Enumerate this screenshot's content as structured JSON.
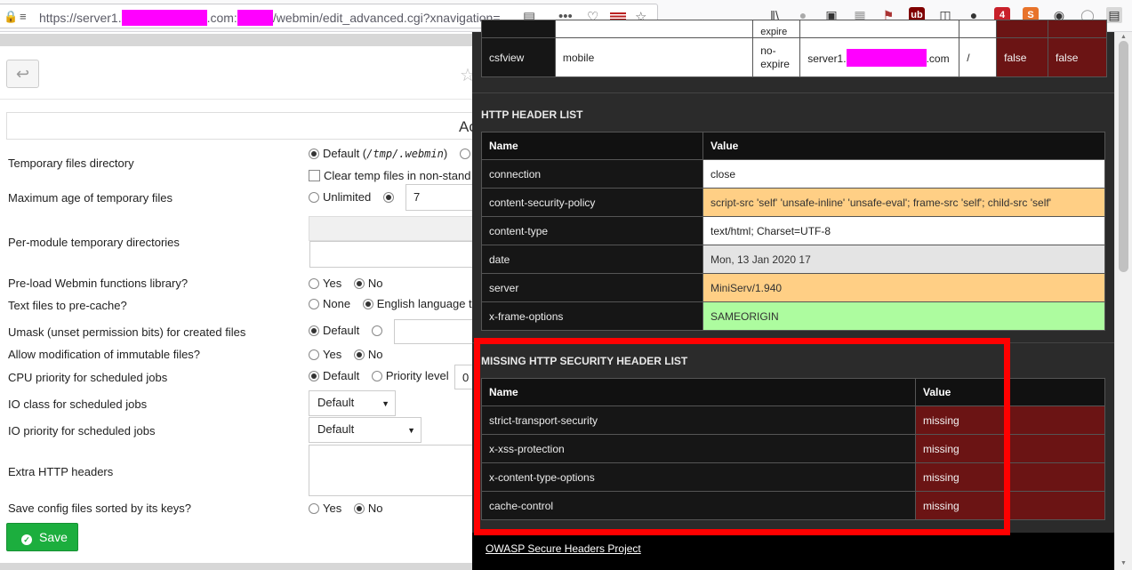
{
  "browser": {
    "url_parts": [
      "https://server1.",
      ".com:",
      "/webmin/edit_advanced.cgi?xnavigation="
    ],
    "icons": [
      "lock-icon",
      "settings-icon",
      "reader-icon",
      "more-icon",
      "pocket-icon",
      "flag-icon",
      "bookmark-star-icon",
      "library-icon",
      "sync-icon",
      "screenshot-icon",
      "reader-view-icon",
      "extension-icon",
      "ublock-icon",
      "sidebar-icon",
      "extension-icon",
      "extension-icon",
      "extension-icon",
      "account-icon",
      "shield-icon",
      "headers-extension-icon"
    ],
    "badges": {
      "ublock": "ub",
      "four": "4",
      "s": "S"
    }
  },
  "page": {
    "panel_title_fragment": "Ac",
    "rows": [
      {
        "label": "Temporary files directory"
      },
      {
        "label": "Maximum age of temporary files"
      },
      {
        "label": "Per-module temporary directories"
      },
      {
        "label": "Pre-load Webmin functions library?"
      },
      {
        "label": "Text files to pre-cache?"
      },
      {
        "label": "Umask (unset permission bits) for created files"
      },
      {
        "label": "Allow modification of immutable files?"
      },
      {
        "label": "CPU priority for scheduled jobs"
      },
      {
        "label": "IO class for scheduled jobs"
      },
      {
        "label": "IO priority for scheduled jobs"
      },
      {
        "label": "Extra HTTP headers"
      },
      {
        "label": "Save config files sorted by its keys?"
      }
    ],
    "opts": {
      "default_paren": "Default (",
      "tmp_path": "/tmp/.webmin",
      "close_paren": ")",
      "clear_temp": "Clear temp files in non-stand",
      "unlimited": "Unlimited",
      "max_age_value": "7",
      "yes": "Yes",
      "no": "No",
      "none": "None",
      "english": "English language te",
      "default": "Default",
      "priority_level": "Priority level",
      "priority_value": "0"
    },
    "save_label": "Save"
  },
  "overlay": {
    "cookie_row": {
      "name": "csfview",
      "value": "mobile",
      "expire": "no-\nexpire",
      "expire_top": "expire",
      "domain_pre": "server1.",
      "domain_post": ".com",
      "path": "/",
      "secure": "false",
      "httponly": "false"
    },
    "http_header_title": "HTTP HEADER LIST",
    "http_headers": {
      "col_name": "Name",
      "col_value": "Value",
      "rows": [
        {
          "name": "connection",
          "value": "close",
          "tone": "white"
        },
        {
          "name": "content-security-policy",
          "value": "script-src 'self' 'unsafe-inline' 'unsafe-eval'; frame-src 'self'; child-src 'self'",
          "tone": "orange"
        },
        {
          "name": "content-type",
          "value": "text/html; Charset=UTF-8",
          "tone": "white"
        },
        {
          "name": "date",
          "value": "Mon, 13 Jan 2020 17",
          "tone": "grey"
        },
        {
          "name": "server",
          "value": "MiniServ/1.940",
          "tone": "orange"
        },
        {
          "name": "x-frame-options",
          "value": "SAMEORIGIN",
          "tone": "green"
        }
      ]
    },
    "missing_title": "MISSING HTTP SECURITY HEADER LIST",
    "missing_headers": {
      "col_name": "Name",
      "col_value": "Value",
      "rows": [
        {
          "name": "strict-transport-security",
          "value": "missing"
        },
        {
          "name": "x-xss-protection",
          "value": "missing"
        },
        {
          "name": "x-content-type-options",
          "value": "missing"
        },
        {
          "name": "cache-control",
          "value": "missing"
        }
      ]
    },
    "owasp_link": "OWASP Secure Headers Project"
  },
  "colors": {
    "highlight": "#ff0000",
    "missing_red": "#6b1414",
    "orange": "#ffcf85",
    "green": "#adfc9f",
    "save_green": "#1cae3e",
    "mask_magenta": "#ff00ff"
  }
}
